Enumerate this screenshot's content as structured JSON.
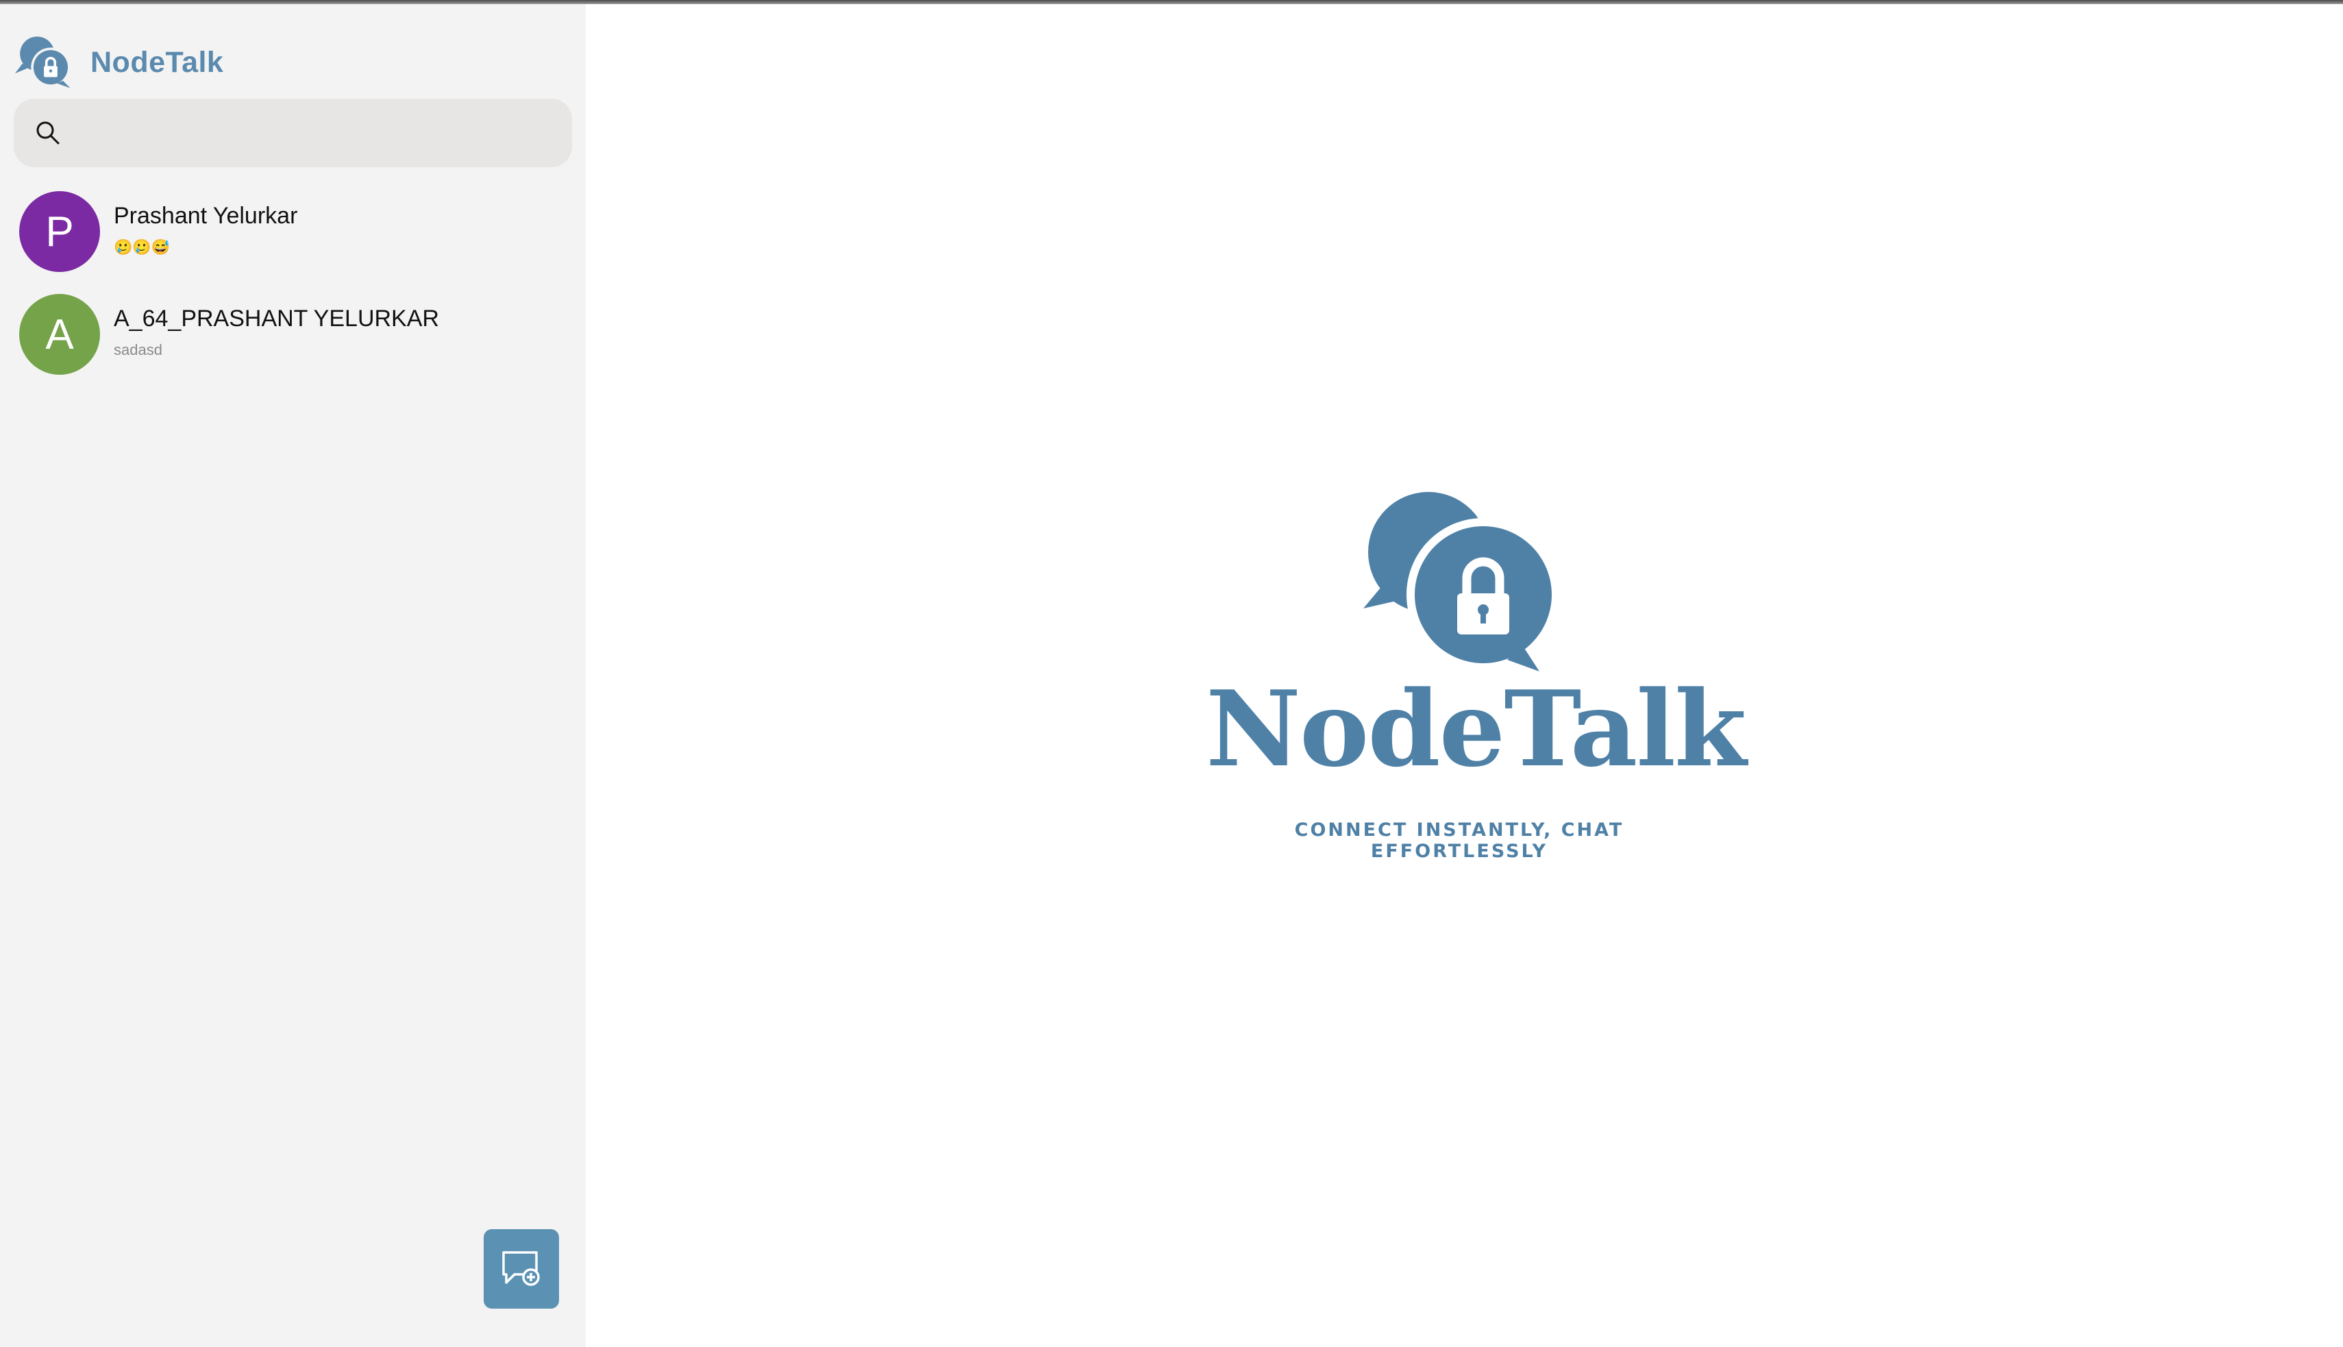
{
  "app": {
    "name": "NodeTalk",
    "brand_color": "#5b8aae",
    "logo_icon": "chat-bubbles-lock-icon"
  },
  "search": {
    "icon": "search-icon",
    "placeholder": "",
    "value": ""
  },
  "contacts": [
    {
      "initial": "P",
      "name": "Prashant Yelurkar",
      "last_message": "🥲🥲😅",
      "avatar_color": "#7b2aa3"
    },
    {
      "initial": "A",
      "name": "A_64_PRASHANT YELURKAR",
      "last_message": "sadasd",
      "avatar_color": "#74a34a"
    }
  ],
  "new_chat_button": {
    "icon": "new-chat-icon",
    "color": "#5b91b3"
  },
  "welcome": {
    "title": "NodeTalk",
    "tagline": "CONNECT INSTANTLY, CHAT EFFORTLESSLY",
    "color": "#4f81a7"
  }
}
